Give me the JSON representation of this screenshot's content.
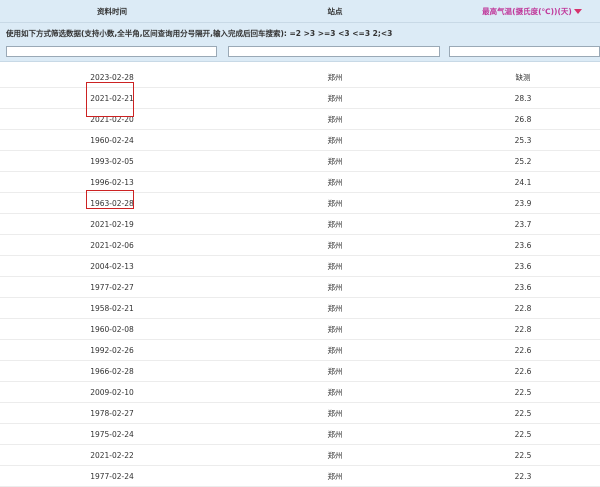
{
  "header": {
    "col_date": "资料时间",
    "col_station": "站点",
    "col_temp": "最高气温(摄氏度(℃))(天)"
  },
  "filter": {
    "hint": "使用如下方式筛选数据(支持小数,全半角,区间查询用分号隔开,输入完成后回车搜索): =2  >3  >=3  <3  <=3  2;<3"
  },
  "rows": [
    {
      "date": "2023-02-28",
      "station": "郑州",
      "temp": "缺测"
    },
    {
      "date": "2021-02-21",
      "station": "郑州",
      "temp": "28.3"
    },
    {
      "date": "2021-02-20",
      "station": "郑州",
      "temp": "26.8"
    },
    {
      "date": "1960-02-24",
      "station": "郑州",
      "temp": "25.3"
    },
    {
      "date": "1993-02-05",
      "station": "郑州",
      "temp": "25.2"
    },
    {
      "date": "1996-02-13",
      "station": "郑州",
      "temp": "24.1"
    },
    {
      "date": "1963-02-28",
      "station": "郑州",
      "temp": "23.9"
    },
    {
      "date": "2021-02-19",
      "station": "郑州",
      "temp": "23.7"
    },
    {
      "date": "2021-02-06",
      "station": "郑州",
      "temp": "23.6"
    },
    {
      "date": "2004-02-13",
      "station": "郑州",
      "temp": "23.6"
    },
    {
      "date": "1977-02-27",
      "station": "郑州",
      "temp": "23.6"
    },
    {
      "date": "1958-02-21",
      "station": "郑州",
      "temp": "22.8"
    },
    {
      "date": "1960-02-08",
      "station": "郑州",
      "temp": "22.8"
    },
    {
      "date": "1992-02-26",
      "station": "郑州",
      "temp": "22.6"
    },
    {
      "date": "1966-02-28",
      "station": "郑州",
      "temp": "22.6"
    },
    {
      "date": "2009-02-10",
      "station": "郑州",
      "temp": "22.5"
    },
    {
      "date": "1978-02-27",
      "station": "郑州",
      "temp": "22.5"
    },
    {
      "date": "1975-02-24",
      "station": "郑州",
      "temp": "22.5"
    },
    {
      "date": "2021-02-22",
      "station": "郑州",
      "temp": "22.5"
    },
    {
      "date": "1977-02-24",
      "station": "郑州",
      "temp": "22.3"
    }
  ]
}
